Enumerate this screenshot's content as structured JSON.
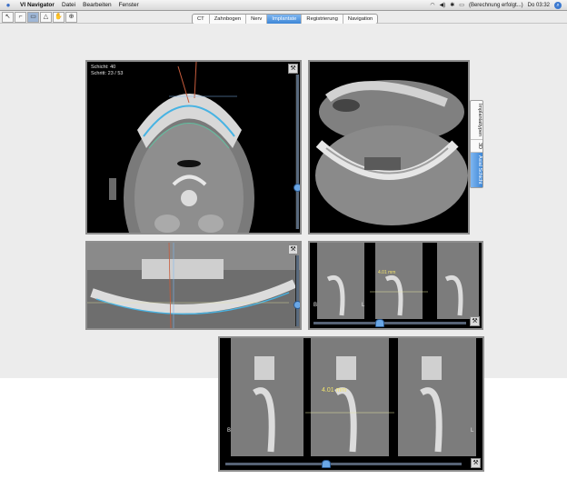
{
  "app": {
    "name": "VI Navigator"
  },
  "menu": [
    "Datei",
    "Bearbeiten",
    "Fenster"
  ],
  "status": {
    "message": "Berechnung erfolgt...",
    "time": "Do 03:32"
  },
  "tabs": [
    {
      "label": "CT",
      "active": false
    },
    {
      "label": "Zahnbogen",
      "active": false
    },
    {
      "label": "Nerv",
      "active": false
    },
    {
      "label": "Implantate",
      "active": true
    },
    {
      "label": "Registrierung",
      "active": false
    },
    {
      "label": "Navigation",
      "active": false
    }
  ],
  "side_tabs": [
    {
      "label": "Implantattypen",
      "active": false
    },
    {
      "label": "3D",
      "active": false
    },
    {
      "label": "Axial Schicht",
      "active": true
    }
  ],
  "axial_panel": {
    "line1": "Schicht: 40",
    "line2": "Schritt: 23 / 53"
  },
  "cross_small": {
    "measurement": "4.01 mm",
    "b_label": "B",
    "l_label": "L"
  },
  "cross_large": {
    "measurement": "4.01 mm",
    "b_label": "B",
    "l_label": "L"
  },
  "colors": {
    "accent": "#3c86d6",
    "measurement": "#f1e36d",
    "arch_curve": "#47b3e3"
  },
  "icons": {
    "apple": "apple-icon",
    "tools": [
      "pointer-icon",
      "crop-icon",
      "window-level-icon",
      "measure-icon",
      "hand-icon",
      "zoom-icon"
    ],
    "status": [
      "wifi-icon",
      "volume-icon",
      "bluetooth-icon",
      "battery-icon",
      "spotlight-icon"
    ]
  }
}
